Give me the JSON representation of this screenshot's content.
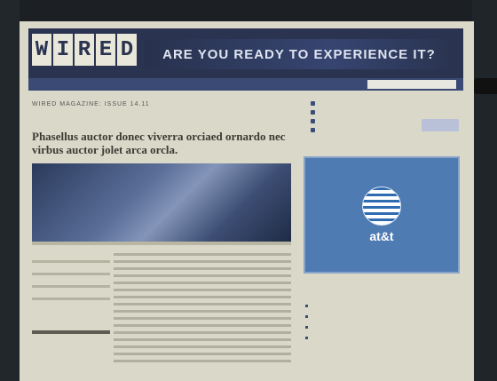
{
  "header": {
    "logo_letters": [
      "W",
      "I",
      "R",
      "E",
      "D"
    ],
    "banner_text": "ARE YOU READY TO EXPERIENCE IT?"
  },
  "nav": {
    "items": [
      "",
      "",
      "",
      "",
      ""
    ],
    "search_placeholder": ""
  },
  "article": {
    "breadcrumb": "WIRED MAGAZINE: ISSUE 14.11",
    "headline": "Phasellus auctor donec viverra orciaed ornardo nec virbus auctor jolet arca orcla."
  },
  "sidebar": {
    "ad_brand": "at&t"
  },
  "colors": {
    "header_bg": "#2a3450",
    "nav_bg": "#3a4a74",
    "ad_bg": "#4f7bb3",
    "page_bg": "#d9d8c9"
  }
}
